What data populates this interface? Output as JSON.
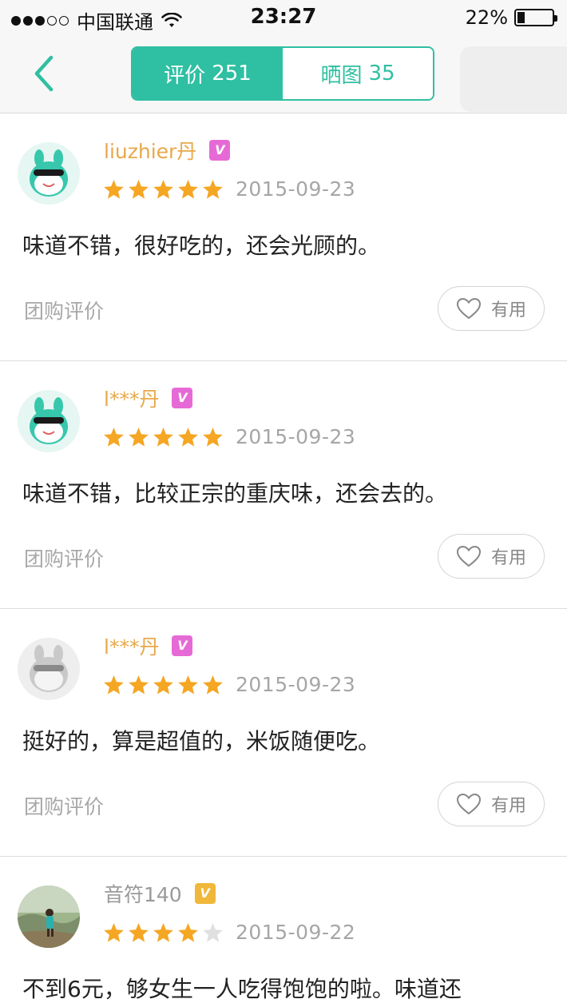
{
  "status_bar": {
    "carrier": "中国联通",
    "time": "23:27",
    "battery_text": "22%",
    "battery_level": 0.22,
    "signal_bars": 5,
    "signal_filled": 3
  },
  "nav": {
    "back_icon": "chevron-left-icon",
    "tabs": [
      {
        "label": "评价",
        "count": "251",
        "active": true
      },
      {
        "label": "晒图",
        "count": "35",
        "active": false
      }
    ],
    "accent_color": "#2fbfa2"
  },
  "reviews": [
    {
      "username": "liuzhier丹",
      "badge": "V",
      "badge_color": "#e66ad6",
      "avatar": "green-mascot-avatar",
      "stars": 5,
      "date": "2015-09-23",
      "text": "味道不错，很好吃的，还会光顾的。",
      "tag": "团购评价",
      "useful_label": "有用"
    },
    {
      "username": "l***丹",
      "badge": "V",
      "badge_color": "#e66ad6",
      "avatar": "green-mascot-avatar",
      "stars": 5,
      "date": "2015-09-23",
      "text": "味道不错，比较正宗的重庆味，还会去的。",
      "tag": "团购评价",
      "useful_label": "有用"
    },
    {
      "username": "l***丹",
      "badge": "V",
      "badge_color": "#e66ad6",
      "avatar": "gray-mascot-avatar",
      "stars": 5,
      "date": "2015-09-23",
      "text": "挺好的，算是超值的，米饭随便吃。",
      "tag": "团购评价",
      "useful_label": "有用"
    },
    {
      "username": "音符140",
      "badge": "V",
      "badge_color": "#f0b73a",
      "avatar": "photo-avatar",
      "stars": 4,
      "date": "2015-09-22",
      "text": "不到6元，够女生一人吃得饱饱的啦。味道还",
      "tag": "",
      "useful_label": ""
    }
  ],
  "colors": {
    "star_on": "#f5a623",
    "star_off": "#e0e0e0"
  }
}
